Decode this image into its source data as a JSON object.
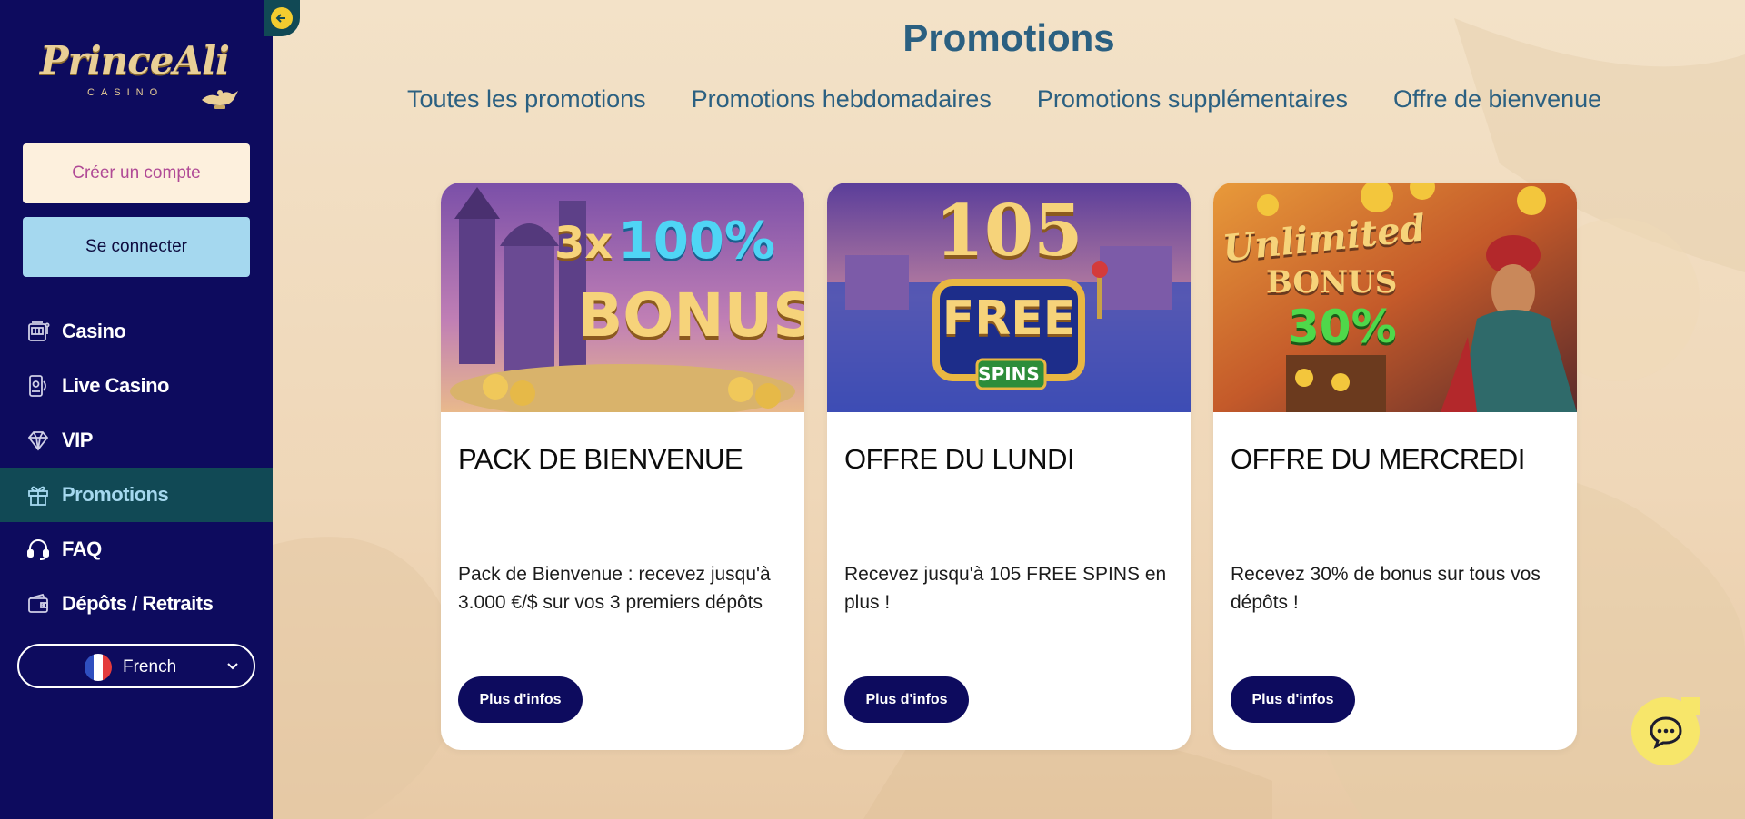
{
  "brand": {
    "logo_text": "PrinceAli",
    "logo_sub": "CASINO"
  },
  "auth": {
    "create_account": "Créer un compte",
    "login": "Se connecter"
  },
  "sidebar": {
    "items": [
      {
        "label": "Casino",
        "icon": "slot-machine-icon"
      },
      {
        "label": "Live Casino",
        "icon": "live-phone-icon"
      },
      {
        "label": "VIP",
        "icon": "diamond-icon"
      },
      {
        "label": "Promotions",
        "icon": "gift-icon",
        "active": true
      },
      {
        "label": "FAQ",
        "icon": "headset-icon"
      },
      {
        "label": "Dépôts / Retraits",
        "icon": "wallet-icon"
      }
    ],
    "language": {
      "selected": "French",
      "flag_colors": [
        "#2f4fbf",
        "#ffffff",
        "#e43b3b"
      ]
    }
  },
  "main": {
    "title": "Promotions",
    "tabs": [
      {
        "label": "Toutes les promotions"
      },
      {
        "label": "Promotions hebdomadaires"
      },
      {
        "label": "Promotions supplémentaires"
      },
      {
        "label": "Offre de bienvenue"
      }
    ],
    "cards": [
      {
        "banner_text": [
          "3x",
          "100%",
          "BONUS"
        ],
        "title": "PACK DE BIENVENUE",
        "description": "Pack de Bienvenue : recevez jusqu'à 3.000 €/$ sur vos 3 premiers dépôts",
        "button": "Plus d'infos"
      },
      {
        "banner_text": [
          "105",
          "FREE",
          "SPINS"
        ],
        "title": "OFFRE DU LUNDI",
        "description": "Recevez jusqu'à 105 FREE SPINS en plus !",
        "button": "Plus d'infos"
      },
      {
        "banner_text": [
          "Unlimited",
          "BONUS",
          "30%"
        ],
        "title": "OFFRE DU MERCREDI",
        "description": "Recevez 30% de bonus sur tous vos dépôts !",
        "button": "Plus d'infos"
      }
    ]
  },
  "colors": {
    "sidebar_bg": "#0d0b5e",
    "active_bg": "#114955",
    "accent_blue": "#2b6081",
    "create_btn_bg": "#fdf0dd",
    "login_btn_bg": "#a5d8ef",
    "chat_bg": "#f7e66a"
  },
  "chat": {
    "icon": "chat-bubble-icon"
  }
}
